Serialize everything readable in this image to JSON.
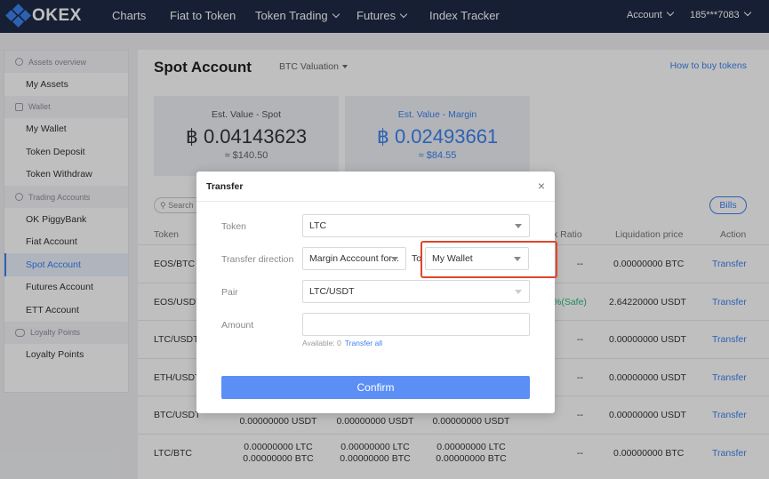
{
  "nav": {
    "logo": "OKEX",
    "items": [
      "Charts",
      "Fiat to Token",
      "Token Trading",
      "Futures",
      "Index Tracker"
    ],
    "account": "Account",
    "phone": "185***7083"
  },
  "sidebar": {
    "groups": [
      {
        "title": "Assets overview",
        "items": [
          "My Assets"
        ]
      },
      {
        "title": "Wallet",
        "items": [
          "My Wallet",
          "Token Deposit",
          "Token Withdraw"
        ]
      },
      {
        "title": "Trading Accounts",
        "items": [
          "OK PiggyBank",
          "Fiat Account",
          "Spot Account",
          "Futures Account",
          "ETT Account"
        ]
      },
      {
        "title": "Loyalty Points",
        "items": [
          "Loyalty Points"
        ]
      }
    ],
    "active": "Spot Account"
  },
  "main": {
    "title": "Spot Account",
    "valuation": "BTC Valuation",
    "howto": "How to buy tokens",
    "cards": [
      {
        "label": "Est. Value - Spot",
        "value": "฿ 0.04143623",
        "sub": "≈ $140.50"
      },
      {
        "label": "Est. Value - Margin",
        "value": "฿ 0.02493661",
        "sub": "≈ $84.55"
      }
    ],
    "search": "Search",
    "bills": "Bills",
    "headers": {
      "token": "Token",
      "risk": "k Ratio",
      "liq": "Liquidation price",
      "action": "Action"
    },
    "rows": [
      {
        "token": "EOS/BTC",
        "risk": "--",
        "liq": "0.00000000 BTC",
        "action": "Transfer"
      },
      {
        "token": "EOS/USDT",
        "risk": "%(Safe)",
        "liq": "2.64220000 USDT",
        "action": "Transfer"
      },
      {
        "token": "LTC/USDT",
        "risk": "--",
        "liq": "0.00000000 USDT",
        "action": "Transfer"
      },
      {
        "token": "ETH/USDT",
        "risk": "--",
        "liq": "0.00000000 USDT",
        "action": "Transfer"
      },
      {
        "token": "BTC/USDT",
        "risk": "--",
        "liq": "0.00000000 USDT",
        "action": "Transfer",
        "balances": [
          "0.00000000 USDT",
          "0.00000000 USDT",
          "0.00000000 USDT"
        ]
      },
      {
        "token": "LTC/BTC",
        "risk": "--",
        "liq": "0.00000000 BTC",
        "action": "Transfer",
        "balances": [
          [
            "0.00000000 LTC",
            "0.00000000 BTC"
          ],
          [
            "0.00000000 LTC",
            "0.00000000 BTC"
          ],
          [
            "0.00000000 LTC",
            "0.00000000 BTC"
          ]
        ]
      }
    ]
  },
  "modal": {
    "title": "Transfer",
    "close": "×",
    "token_label": "Token",
    "token_value": "LTC",
    "direction_label": "Transfer direction",
    "from_value": "Margin Acccount for...",
    "to_label": "To",
    "to_value": "My Wallet",
    "pair_label": "Pair",
    "pair_value": "LTC/USDT",
    "amount_label": "Amount",
    "amount_value": "",
    "available_label": "Available: 0",
    "transfer_all": "Transfer all",
    "confirm": "Confirm"
  },
  "colors": {
    "accent": "#3d82f0",
    "nav_bg": "#1e2a44",
    "highlight": "#e0452b",
    "safe": "#2bb87a"
  }
}
